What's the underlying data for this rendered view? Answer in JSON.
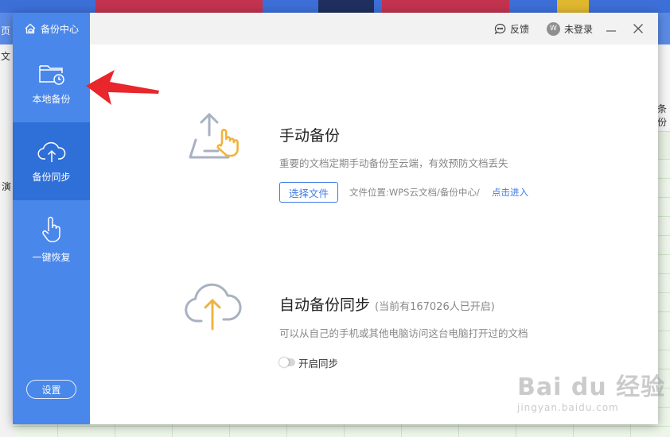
{
  "sidebar": {
    "header": "备份中心",
    "items": [
      {
        "label": "本地备份",
        "icon": "folder-clock-icon",
        "active": false
      },
      {
        "label": "备份同步",
        "icon": "cloud-upload-icon",
        "active": true
      },
      {
        "label": "一键恢复",
        "icon": "hand-touch-icon",
        "active": false
      }
    ],
    "settings_label": "设置"
  },
  "titlebar": {
    "feedback_label": "反馈",
    "login_label": "未登录",
    "avatar_text": "W"
  },
  "manual_backup": {
    "title": "手动备份",
    "description": "重要的文档定期手动备份至云端，有效预防文档丢失",
    "button_label": "选择文件",
    "path_text": "文件位置:WPS云文档/备份中心/",
    "path_link": "点击进入"
  },
  "auto_sync": {
    "title": "自动备份同步",
    "subtitle": "(当前有167026人已开启)",
    "description": "可以从自己的手机或其他电脑访问这台电脑打开过的文档",
    "toggle_label": "开启同步",
    "toggle_on": false
  },
  "background": {
    "tab_text": "页",
    "menu_text": "文",
    "side_text": "演",
    "right_text": "条份"
  },
  "watermark": {
    "main": "Bai du 经验",
    "sub": "jingyan.baidu.com"
  },
  "colors": {
    "sidebar": "#4a87ea",
    "sidebar_active": "#2f6fd8",
    "accent": "#3d7be6",
    "arrow": "#e8262b",
    "icon_orange": "#f0b43c"
  }
}
